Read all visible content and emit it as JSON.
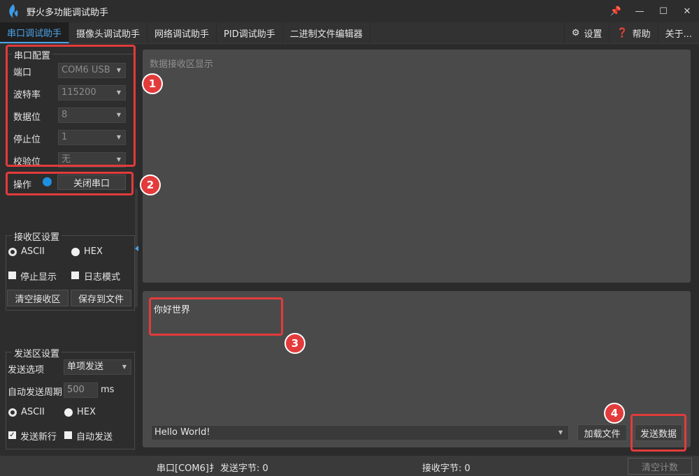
{
  "window": {
    "title": "野火多功能调试助手",
    "controls": [
      "📌",
      "—",
      "☐",
      "✕"
    ]
  },
  "tabs": [
    {
      "label": "串口调试助手",
      "active": true
    },
    {
      "label": "摄像头调试助手"
    },
    {
      "label": "网络调试助手"
    },
    {
      "label": "PID调试助手"
    },
    {
      "label": "二进制文件编辑器"
    }
  ],
  "tabs_right": [
    {
      "icon": "gear-icon",
      "glyph": "⚙",
      "label": "设置"
    },
    {
      "icon": "help-icon",
      "glyph": "❓",
      "label": "帮助"
    },
    {
      "label": "关于..."
    }
  ],
  "serial_config": {
    "title": "串口配置",
    "port_label": "端口",
    "port_value": "COM6 USB",
    "baud_label": "波特率",
    "baud_value": "115200",
    "databits_label": "数据位",
    "databits_value": "8",
    "stopbits_label": "停止位",
    "stopbits_value": "1",
    "parity_label": "校验位",
    "parity_value": "无"
  },
  "operation": {
    "label": "操作",
    "close_button": "关闭串口",
    "led_color": "#1e90e0"
  },
  "recv_settings": {
    "title": "接收区设置",
    "ascii": "ASCII",
    "hex": "HEX",
    "stop_display": "停止显示",
    "log_mode": "日志模式",
    "clear_button": "清空接收区",
    "save_button": "保存到文件"
  },
  "send_settings": {
    "title": "发送区设置",
    "option_label": "发送选项",
    "option_value": "单项发送",
    "period_label": "自动发送周期",
    "period_value": "500",
    "period_unit": "ms",
    "ascii": "ASCII",
    "hex": "HEX",
    "newline": "发送新行",
    "auto_send": "自动发送"
  },
  "receive_area": {
    "placeholder": "数据接收区显示"
  },
  "send_area": {
    "text": "你好世界",
    "history_value": "Hello World!",
    "load_file_button": "加载文件",
    "send_button": "发送数据"
  },
  "statusbar": {
    "port_status": "串口[COM6]扌",
    "sent_bytes": "发送字节: 0",
    "recv_bytes": "接收字节: 0",
    "clear_count": "清空计数"
  },
  "annotations": {
    "marker_1": "1",
    "marker_2": "2",
    "marker_3": "3",
    "marker_4": "4",
    "highlight_color": "#e33b3b"
  }
}
